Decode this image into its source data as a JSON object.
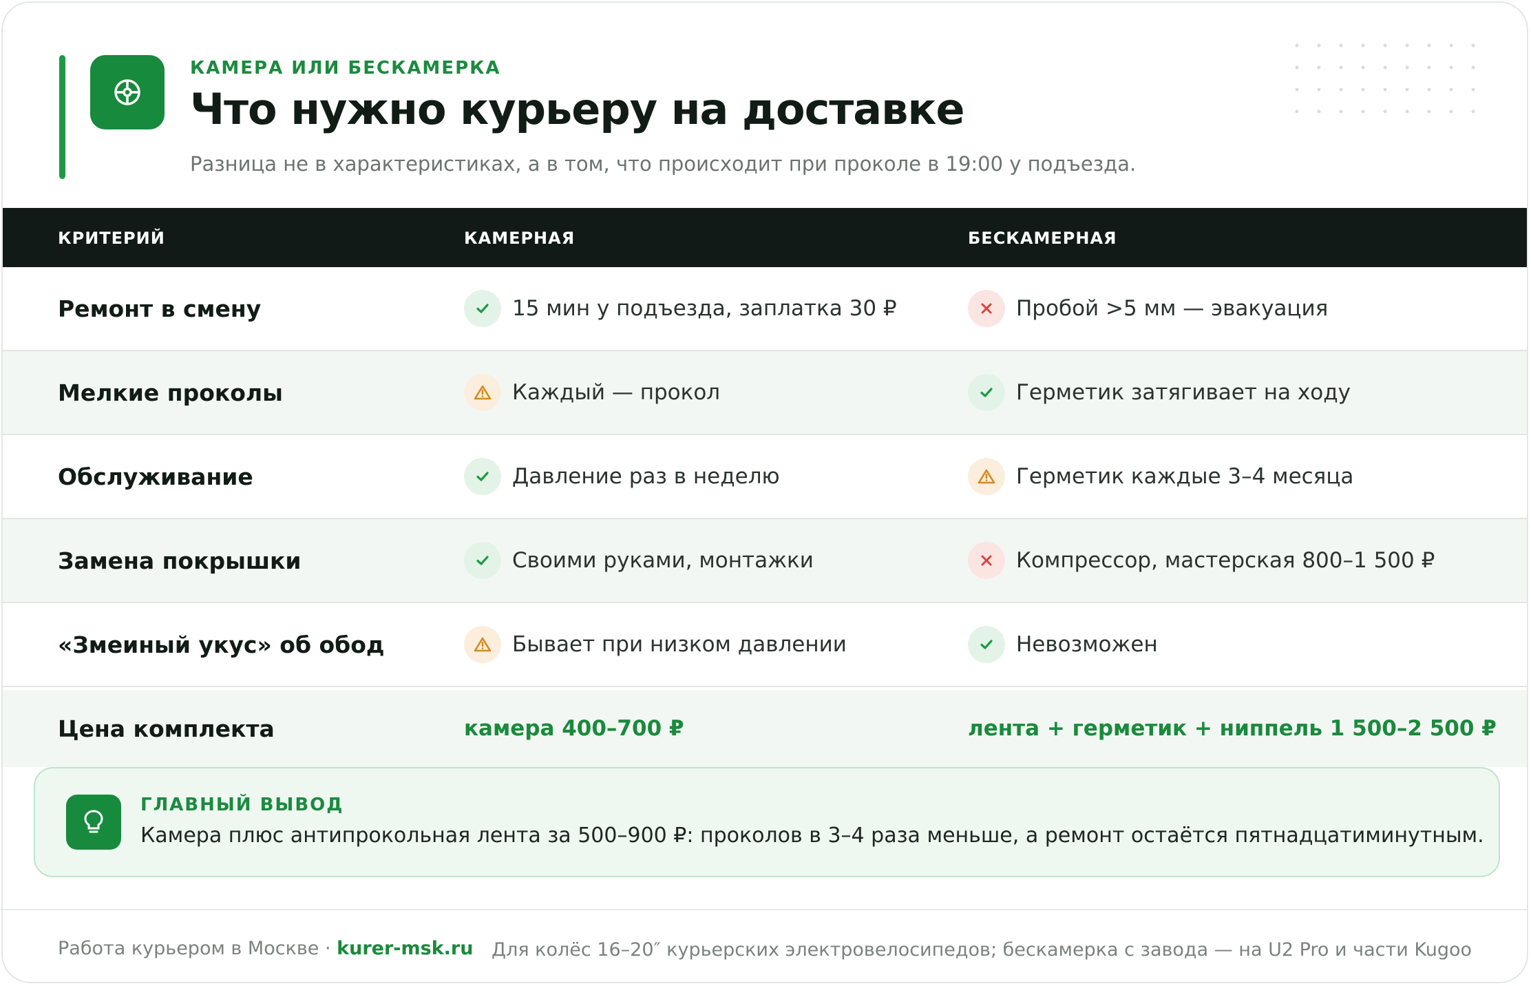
{
  "header": {
    "eyebrow": "КАМЕРА ИЛИ БЕСКАМЕРКА",
    "title": "Что нужно курьеру на доставке",
    "subtitle": "Разница не в характеристиках, а в том, что происходит при проколе в 19:00 у подъезда.",
    "logo_icon": "wheel-icon"
  },
  "table": {
    "headers": [
      "КРИТЕРИЙ",
      "КАМЕРНАЯ",
      "БЕСКАМЕРНАЯ"
    ],
    "rows": [
      {
        "criterion": "Ремонт в смену",
        "tube": {
          "status": "ok",
          "text": "15 мин у подъезда, заплатка 30 ₽"
        },
        "tubeless": {
          "status": "no",
          "text": "Пробой >5 мм — эвакуация"
        }
      },
      {
        "criterion": "Мелкие проколы",
        "tube": {
          "status": "warn",
          "text": "Каждый — прокол"
        },
        "tubeless": {
          "status": "ok",
          "text": "Герметик затягивает на ходу"
        }
      },
      {
        "criterion": "Обслуживание",
        "tube": {
          "status": "ok",
          "text": "Давление раз в неделю"
        },
        "tubeless": {
          "status": "warn",
          "text": "Герметик каждые 3–4 месяца"
        }
      },
      {
        "criterion": "Замена покрышки",
        "tube": {
          "status": "ok",
          "text": "Своими руками, монтажки"
        },
        "tubeless": {
          "status": "no",
          "text": "Компрессор, мастерская 800–1 500 ₽"
        }
      },
      {
        "criterion": "«Змеиный укус» об обод",
        "tube": {
          "status": "warn",
          "text": "Бывает при низком давлении"
        },
        "tubeless": {
          "status": "ok",
          "text": "Невозможен"
        }
      }
    ],
    "price_row": {
      "criterion": "Цена комплекта",
      "tube": "камера 400–700 ₽",
      "tubeless": "лента + герметик + ниппель 1 500–2 500 ₽"
    }
  },
  "callout": {
    "label": "ГЛАВНЫЙ ВЫВОД",
    "text": "Камера плюс антипрокольная лента за 500–900 ₽: проколов в 3–4 раза меньше, а ремонт остаётся пятнадцатиминутным.",
    "icon": "lightbulb-icon"
  },
  "footer": {
    "left_text": "Работа курьером в Москве · ",
    "site": "kurer-msk.ru",
    "right_text": "Для колёс 16–20″ курьерских электровелосипедов; бескамерка с завода — на U2 Pro и части Kugoo"
  },
  "colors": {
    "accent": "#178a3d",
    "header_bg": "#111a16",
    "ok": "#1e9a45",
    "no": "#d9443b",
    "warn": "#d48a1e"
  }
}
